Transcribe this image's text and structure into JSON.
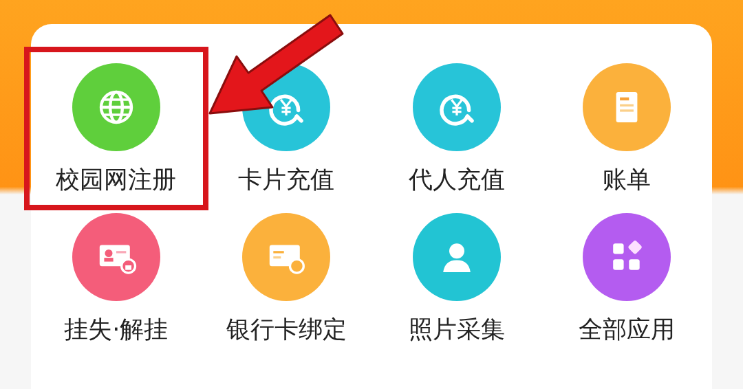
{
  "services": [
    {
      "label": "校园网注册",
      "kind": "globe",
      "color": "#5fcf3c",
      "highlighted": true
    },
    {
      "label": "卡片充值",
      "kind": "yen",
      "color": "#27c4d8",
      "highlighted": false
    },
    {
      "label": "代人充值",
      "kind": "yen",
      "color": "#27c4d8",
      "highlighted": false
    },
    {
      "label": "账单",
      "kind": "bill",
      "color": "#fbb13c",
      "highlighted": false
    },
    {
      "label": "挂失·解挂",
      "kind": "idcard",
      "color": "#f45d7a",
      "highlighted": false
    },
    {
      "label": "银行卡绑定",
      "kind": "bankcard",
      "color": "#fbb13c",
      "highlighted": false
    },
    {
      "label": "照片采集",
      "kind": "person",
      "color": "#22c4d3",
      "highlighted": false
    },
    {
      "label": "全部应用",
      "kind": "apps",
      "color": "#b45cf0",
      "highlighted": false
    }
  ]
}
